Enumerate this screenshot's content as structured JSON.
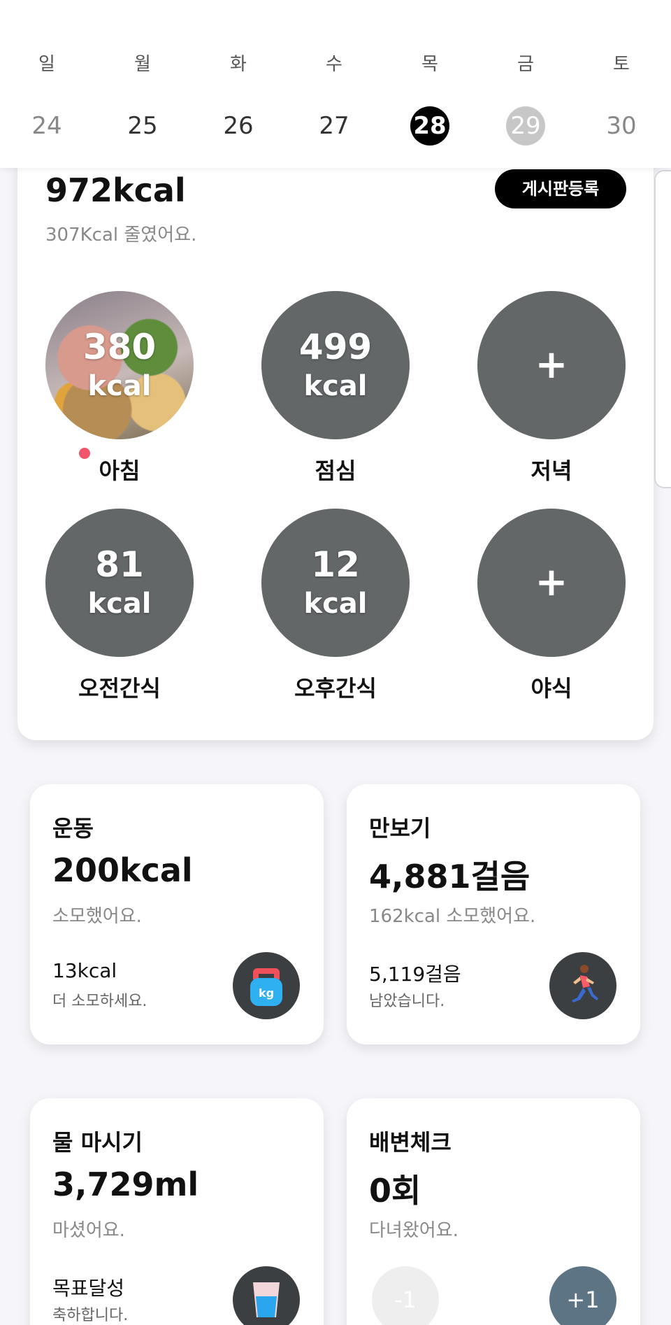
{
  "week": {
    "days": [
      "일",
      "월",
      "화",
      "수",
      "목",
      "금",
      "토"
    ],
    "dates": [
      "24",
      "25",
      "26",
      "27",
      "28",
      "29",
      "30"
    ]
  },
  "meals": {
    "total_kcal": "972kcal",
    "subtitle": "307Kcal 줄였어요.",
    "post_button": "게시판등록",
    "items": [
      {
        "label": "아침",
        "num": "380",
        "unit": "kcal"
      },
      {
        "label": "점심",
        "num": "499",
        "unit": "kcal"
      },
      {
        "label": "저녁",
        "plus": "+"
      },
      {
        "label": "오전간식",
        "num": "81",
        "unit": "kcal"
      },
      {
        "label": "오후간식",
        "num": "12",
        "unit": "kcal"
      },
      {
        "label": "야식",
        "plus": "+"
      }
    ]
  },
  "exercise": {
    "title": "운동",
    "value": "200kcal",
    "sub": "소모했어요.",
    "foot_main": "13kcal",
    "foot_sub": "더 소모하세요.",
    "icon": "kettlebell-icon",
    "icon_text": "kg"
  },
  "steps": {
    "title": "만보기",
    "value": "4,881걸음",
    "sub": "162kcal 소모했어요.",
    "foot_main": "5,119걸음",
    "foot_sub": "남았습니다.",
    "icon": "runner-icon"
  },
  "water": {
    "title": "물 마시기",
    "value": "3,729ml",
    "sub": "마셨어요.",
    "foot_main": "목표달성",
    "foot_sub": "축하합니다.",
    "icon": "water-glass-icon"
  },
  "bowel": {
    "title": "배변체크",
    "value": "0회",
    "sub": "다녀왔어요.",
    "minus_label": "-1",
    "plus_label": "+1"
  }
}
